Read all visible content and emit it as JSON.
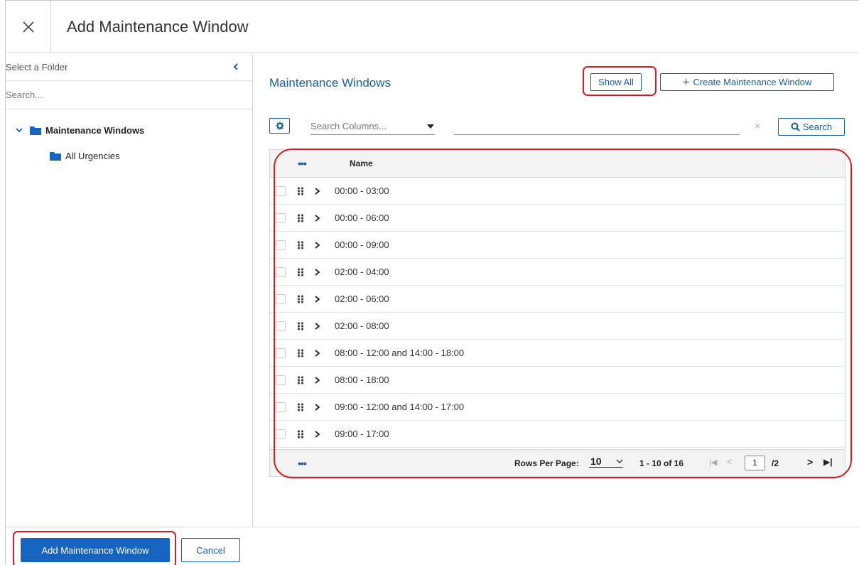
{
  "dialog": {
    "title": "Add Maintenance Window",
    "close_icon": "close-icon"
  },
  "sidebar": {
    "label": "Select a Folder",
    "collapse_icon": "chevron-left-icon",
    "search_placeholder": "Search...",
    "tree": {
      "root": {
        "label": "Maintenance Windows",
        "expanded": true,
        "icon": "folder-icon"
      },
      "children": [
        {
          "label": "All Urgencies",
          "icon": "folder-icon"
        }
      ]
    }
  },
  "main": {
    "title": "Maintenance Windows",
    "show_all_label": "Show All",
    "create_label": "Create Maintenance Window",
    "create_icon": "plus-icon",
    "search": {
      "settings_icon": "gear-icon",
      "column_placeholder": "Search Columns...",
      "term_value": "",
      "clear_glyph": "×",
      "search_label": "Search",
      "search_icon": "magnifier-icon"
    },
    "grid": {
      "column_menu_glyph": "•••",
      "header_name": "Name",
      "rows": [
        {
          "name": "00:00 - 03:00"
        },
        {
          "name": "00:00 - 06:00"
        },
        {
          "name": "00:00 - 09:00"
        },
        {
          "name": "02:00 - 04:00"
        },
        {
          "name": "02:00 - 06:00"
        },
        {
          "name": "02:00 - 08:00"
        },
        {
          "name": "08:00 - 12:00 and 14:00 - 18:00"
        },
        {
          "name": "08:00 - 18:00"
        },
        {
          "name": "09:00 - 12:00 and 14:00 - 17:00"
        },
        {
          "name": "09:00 - 17:00"
        }
      ],
      "footer": {
        "menu_glyph": "•••",
        "rows_per_page_label": "Rows Per Page:",
        "rows_per_page_value": "10",
        "range_text": "1 - 10 of 16",
        "first_glyph": "|◀",
        "prev_glyph": "<",
        "page_value": "1",
        "page_total": "/2",
        "next_glyph": ">",
        "last_glyph": "▶|"
      }
    }
  },
  "footer": {
    "primary_label": "Add Maintenance Window",
    "cancel_label": "Cancel"
  },
  "colors": {
    "accent": "#1a5fa0",
    "primary_button": "#1565c0",
    "highlight": "#cc1f1f"
  }
}
